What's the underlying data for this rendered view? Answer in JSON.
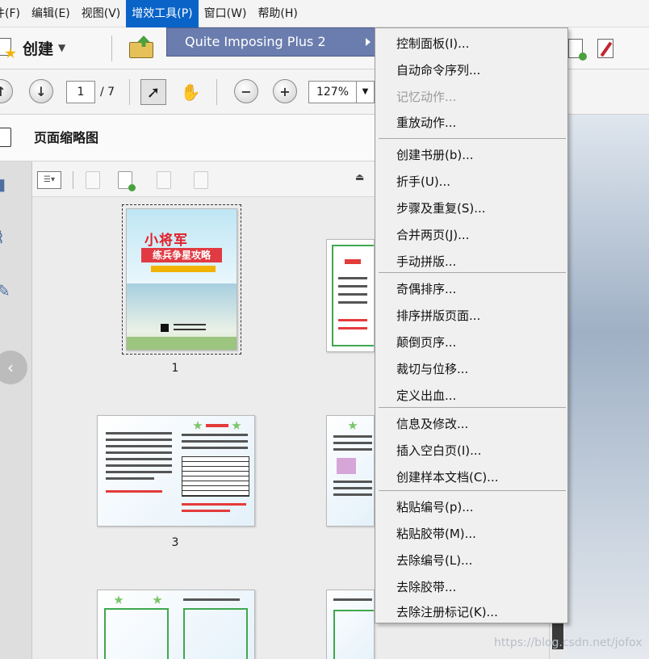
{
  "menubar": {
    "items": [
      "件(F)",
      "编辑(E)",
      "视图(V)",
      "增效工具(P)",
      "窗口(W)",
      "帮助(H)"
    ]
  },
  "toolbar": {
    "create_label": "创建",
    "page_current": "1",
    "page_total": "/ 7",
    "zoom": "127%"
  },
  "panel": {
    "title": "页面缩略图"
  },
  "thumbnails": {
    "labels": [
      "1",
      "3"
    ]
  },
  "cover": {
    "title": "小将军",
    "subtitle": "练兵争星攻略"
  },
  "submenu_plugins": {
    "item": "Quite Imposing Plus 2"
  },
  "submenu_qi": {
    "items": [
      {
        "label": "控制面板(I)...",
        "disabled": false
      },
      {
        "label": "自动命令序列...",
        "disabled": false
      },
      {
        "label": "记忆动作...",
        "disabled": true
      },
      {
        "label": "重放动作...",
        "disabled": false
      },
      {
        "label": "创建书册(b)...",
        "disabled": false
      },
      {
        "label": "折手(U)...",
        "disabled": false
      },
      {
        "label": "步骤及重复(S)...",
        "disabled": false
      },
      {
        "label": "合并两页(J)...",
        "disabled": false
      },
      {
        "label": "手动拼版...",
        "disabled": false
      },
      {
        "label": "奇偶排序...",
        "disabled": false
      },
      {
        "label": "排序拼版页面...",
        "disabled": false
      },
      {
        "label": "颠倒页序...",
        "disabled": false
      },
      {
        "label": "裁切与位移...",
        "disabled": false
      },
      {
        "label": "定义出血...",
        "disabled": false
      },
      {
        "label": "信息及修改...",
        "disabled": false
      },
      {
        "label": "插入空白页(I)...",
        "disabled": false
      },
      {
        "label": "创建样本文档(C)...",
        "disabled": false
      },
      {
        "label": "粘贴编号(p)...",
        "disabled": false
      },
      {
        "label": "粘贴胶带(M)...",
        "disabled": false
      },
      {
        "label": "去除编号(L)...",
        "disabled": false
      },
      {
        "label": "去除胶带...",
        "disabled": false
      },
      {
        "label": "去除注册标记(K)...",
        "disabled": false
      }
    ]
  },
  "watermark": "https://blog.csdn.net/jofox",
  "colors": {
    "menu_highlight": "#0a64c8",
    "submenu_highlight": "#6b7dae"
  }
}
